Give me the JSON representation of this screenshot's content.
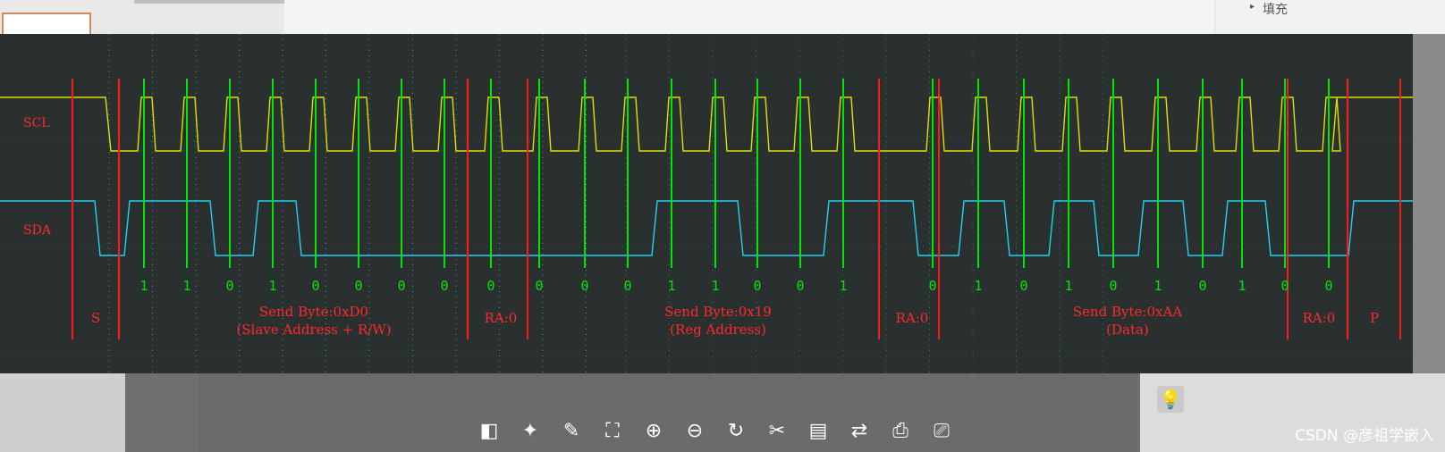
{
  "top_panel": {
    "fill_label": "填充"
  },
  "scope": {
    "channels": [
      {
        "name": "SCL",
        "color": "#e0e000"
      },
      {
        "name": "SDA",
        "color": "#22d3f0"
      }
    ],
    "bits": [
      "1",
      "1",
      "0",
      "1",
      "0",
      "0",
      "0",
      "0",
      "0",
      "0",
      "0",
      "0",
      "1",
      "1",
      "0",
      "0",
      "1",
      "0",
      "1",
      "0",
      "1",
      "0",
      "1",
      "0",
      "1",
      "0",
      "0"
    ],
    "annotations": [
      {
        "lines": [
          "S"
        ]
      },
      {
        "lines": [
          "Send Byte:0xD0",
          "(Slave Address + R/W)"
        ]
      },
      {
        "lines": [
          "RA:0"
        ]
      },
      {
        "lines": [
          "Send Byte:0x19",
          "(Reg Address)"
        ]
      },
      {
        "lines": [
          "RA:0"
        ]
      },
      {
        "lines": [
          "Send Byte:0xAA",
          "(Data)"
        ]
      },
      {
        "lines": [
          "RA:0"
        ]
      },
      {
        "lines": [
          "P"
        ]
      }
    ],
    "colors": {
      "background": "#2a2f30",
      "boundary_line": "#ff1a1a",
      "sample_line": "#00e600",
      "grid": "#2fa58a",
      "bit_text": "#00e600",
      "annotation_text": "#ff2a2a"
    }
  },
  "toolbar": {
    "icons": [
      "compare-icon",
      "magic-wand-icon",
      "image-edit-icon",
      "fit-screen-icon",
      "zoom-in-icon",
      "zoom-out-icon",
      "rotate-icon",
      "crop-icon",
      "image-to-text-icon",
      "convert-icon",
      "save-icon",
      "print-icon"
    ]
  },
  "watermark": "CSDN @彦祖学嵌入"
}
